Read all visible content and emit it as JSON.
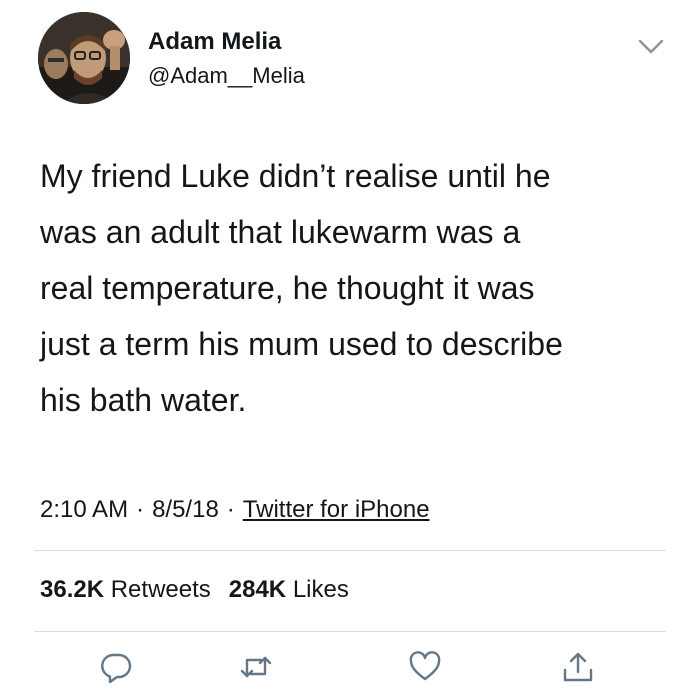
{
  "author": {
    "display_name": "Adam Melia",
    "handle": "@Adam__Melia"
  },
  "tweet": {
    "text": "My friend Luke didn’t realise until he\nwas an adult that lukewarm was a\nreal temperature, he thought it was\njust a term his mum used to describe\nhis bath water.",
    "time": "2:10 AM",
    "date": "8/5/18",
    "separator": "·",
    "source": "Twitter for iPhone"
  },
  "stats": {
    "retweets_count": "36.2K",
    "retweets_label": "Retweets",
    "likes_count": "284K",
    "likes_label": "Likes"
  },
  "icons": {
    "menu": "chevron-down-icon",
    "reply": "reply-icon",
    "retweet": "retweet-icon",
    "like": "heart-icon",
    "share": "share-icon"
  },
  "colors": {
    "text": "#14171a",
    "divider": "#d8dde1",
    "background": "#ffffff"
  }
}
